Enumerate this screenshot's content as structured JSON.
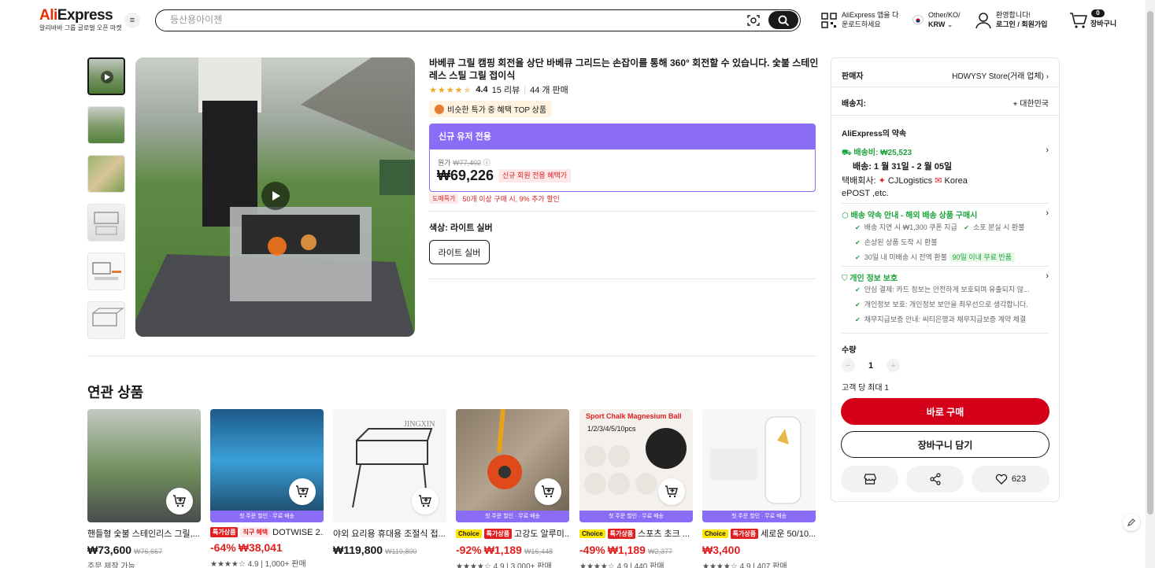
{
  "header": {
    "logo": "AliExpress",
    "logo_sub": "알리바바 그룹 글로벌 오픈 마켓",
    "search_placeholder": "등산용아이젠",
    "app_line1": "AliExpress 앱을 다",
    "app_line2": "운로드하세요",
    "locale_line1": "Other/KO/",
    "locale_line2": "KRW",
    "user_line1": "환영합니다!",
    "user_line2": "로그인 / 회원가입",
    "cart_count": "0",
    "cart_label": "장바구니"
  },
  "product": {
    "title": "바베큐 그릴 캠핑 회전율 상단 바베큐 그리드는 손잡이를 통해 360° 회전할 수 있습니다. 숯불 스테인레스 스틸 그릴 접이식",
    "rating": "4.4",
    "rating_value": 4.4,
    "reviews": "15 리뷰",
    "sold": "44 개 판매",
    "promo_tag": "비슷한 특가 중 혜택 TOP 상품",
    "newuser_title": "신규 유저 전용",
    "orig_label": "원가",
    "orig_price": "₩77,402",
    "price": "₩69,226",
    "newuser_pill": "신규 회원 전용 혜택가",
    "extra_tag": "도매특가",
    "extra_text": "50개 이상 구매 시, 9% 추가 할인",
    "color_label": "색상: 라이트 실버",
    "color_option": "라이트 실버"
  },
  "related": {
    "title": "연관 상품",
    "items": [
      {
        "name": "핸들형 숯불 스테인리스 그릴,...",
        "tag": "",
        "discount": "",
        "price": "₩73,600",
        "orig": "₩76,667",
        "meta": "주문 제작 가능",
        "banner": ""
      },
      {
        "name": "DOTWISE 2...",
        "tag": "특가상품",
        "tag2": "직구 혜택",
        "discount": "-64%",
        "price": "₩38,041",
        "orig": "",
        "meta": "★★★★☆ 4.9 | 1,000+ 판매",
        "banner": "첫 주문 할인 · 무료 배송"
      },
      {
        "name": "야외 요리용 휴대용 조절식 접...",
        "tag": "",
        "discount": "",
        "price": "₩119,800",
        "orig": "₩119,800",
        "meta": "",
        "banner": ""
      },
      {
        "name": "고강도 알루미...",
        "tag": "특가상품",
        "choice": "Choice",
        "discount": "-92%",
        "price": "₩1,189",
        "orig": "₩16,448",
        "meta": "★★★★☆ 4.9 | 3,000+ 판매",
        "banner": "첫 주문 할인 · 무료 배송"
      },
      {
        "name": "스포츠 초크 ...",
        "tag": "특가상품",
        "choice": "Choice",
        "discount": "-49%",
        "price": "₩1,189",
        "orig": "₩2,377",
        "meta": "★★★★☆ 4.9 | 440 판매",
        "banner": "첫 주문 할인 · 무료 배송"
      },
      {
        "name": "세로운 50/10...",
        "tag": "특가상품",
        "choice": "Choice",
        "discount": "",
        "price": "₩3,400",
        "orig": "",
        "meta": "★★★★☆ 4.9 | 407 판매",
        "banner": "첫 주문 할인 · 무료 배송"
      }
    ]
  },
  "panel": {
    "seller_label": "판매자",
    "seller_value": "HDWYSY Store(거래 업체)",
    "ship_to_label": "배송지:",
    "ship_to_value": "대한민국",
    "promise_title": "AliExpress의 약속",
    "shipping_fee": "배송비: ₩25,523",
    "delivery": "배송: 1 월 31일 - 2 월 05일",
    "carrier_line1": "택배회사:",
    "carrier_a": "CJLogistics",
    "carrier_b": "Korea",
    "carrier_line2": "ePOST ,etc.",
    "promise_block_title": "배송 약속 안내 - 해외 배송 상품 구매시",
    "promise_1a": "배송 지연 시 ₩1,300 쿠폰 지급",
    "promise_1b": "소포 분실 시 환불",
    "promise_2": "손상된 상품 도착 시 환불",
    "promise_3": "30일 내 미배송 시 전액 환불",
    "promise_3_pill": "90일 이내 무료 반품",
    "privacy_title": "개인 정보 보호",
    "privacy_1": "안심 결제: 카드 정보는 안전하게 보호되며 유출되지 않...",
    "privacy_2": "개인정보 보호: 개인정보 보안을 최우선으로 생각합니다.",
    "privacy_3": "채무지급보증 안내: 씨티은행과 채무지급보증 계약 체결",
    "qty_label": "수량",
    "qty_value": "1",
    "qty_max": "고객 당 최대 1",
    "buy_now": "바로 구매",
    "add_cart": "장바구니 담기",
    "wishlist_count": "623"
  }
}
